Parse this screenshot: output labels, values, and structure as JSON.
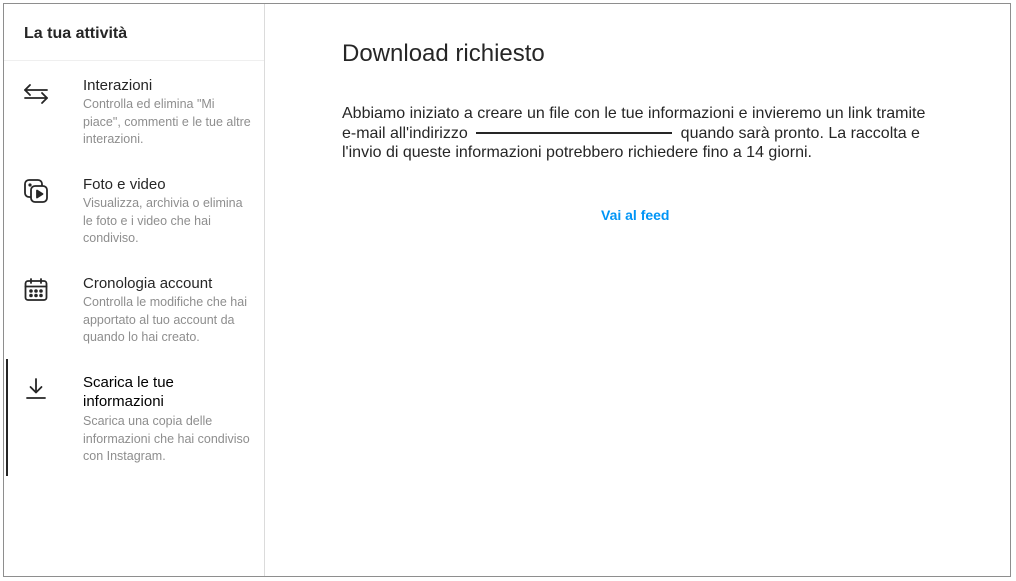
{
  "sidebar": {
    "title": "La tua attività",
    "items": [
      {
        "icon": "arrows-swap-icon",
        "label": "Interazioni",
        "description": "Controlla ed elimina \"Mi piace\", commenti e le tue altre interazioni."
      },
      {
        "icon": "photo-video-icon",
        "label": "Foto e video",
        "description": "Visualizza, archivia o elimina le foto e i video che hai condiviso."
      },
      {
        "icon": "calendar-icon",
        "label": "Cronologia account",
        "description": "Controlla le modifiche che hai apportato al tuo account da quando lo hai creato."
      },
      {
        "icon": "download-icon",
        "label": "Scarica le tue informazioni",
        "description": "Scarica una copia delle informazioni che hai condiviso con Instagram.",
        "active": true
      }
    ]
  },
  "main": {
    "title": "Download richiesto",
    "text_before": "Abbiamo iniziato a creare un file con le tue informazioni e invieremo un link tramite e-mail all'indirizzo",
    "text_after": "quando sarà pronto. La raccolta e l'invio di queste informazioni potrebbero richiedere fino a 14 giorni.",
    "link_label": "Vai al feed"
  },
  "colors": {
    "link": "#0095f6",
    "text": "#262626",
    "secondary_text": "#8e8e8e",
    "border": "#dbdbdb"
  }
}
